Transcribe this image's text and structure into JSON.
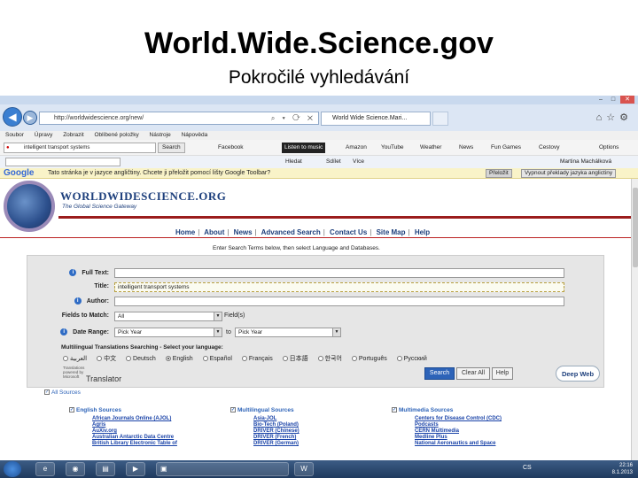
{
  "slide": {
    "title": "World.Wide.Science.gov",
    "subtitle": "Pokročilé vyhledávání"
  },
  "browser": {
    "address": "http://worldwidescience.org/new/",
    "tab_title": "World Wide Science.Mari...",
    "menu": [
      "Soubor",
      "Úpravy",
      "Zobrazit",
      "Oblíbené položky",
      "Nástroje",
      "Nápověda"
    ],
    "toolbar": {
      "search_value": "intelligent transport systems",
      "search_button": "Search",
      "items": [
        "Facebook",
        "Listen to music",
        "Amazon",
        "YouTube",
        "Weather",
        "News",
        "Fun Games",
        "Cestovy",
        "Options"
      ]
    },
    "google_toolbar": {
      "items": [
        "Hledat",
        "Sdílet",
        "Více",
        "Martina Machálková"
      ]
    },
    "translate_bar": {
      "logo": "Google",
      "message": "Tato stránka je v jazyce angličtiny. Chcete ji přeložit pomocí lišty Google Toolbar?",
      "button_translate": "Přeložit",
      "button_always": "Vypnout překlady jazyka anglictiny"
    }
  },
  "site": {
    "logo_text": "WORLDWIDESCIENCE.ORG",
    "tagline": "The Global Science Gateway",
    "nav": [
      "Home",
      "About",
      "News",
      "Advanced Search",
      "Contact Us",
      "Site Map",
      "Help"
    ],
    "instruction": "Enter Search Terms below, then select Language and Databases.",
    "form": {
      "full_text_label": "Full Text:",
      "full_text_value": "",
      "title_label": "Title:",
      "title_value": "intelligent transport systems",
      "author_label": "Author:",
      "author_value": "",
      "fields_label": "Fields to Match:",
      "fields_value": "All",
      "fields_suffix": "Field(s)",
      "date_label": "Date Range:",
      "date_from": "Pick Year",
      "date_to_label": "to",
      "date_to": "Pick Year"
    },
    "multilingual_heading": "Multilingual Translations Searching - Select your language:",
    "languages": [
      "العربية",
      "中文",
      "Deutsch",
      "English",
      "Español",
      "Français",
      "日本語",
      "한국어",
      "Português",
      "Русский"
    ],
    "selected_language": "English",
    "translator_small": "Translations powered by Microsoft",
    "translator_label": "Translator",
    "buttons": {
      "search": "Search",
      "clear": "Clear All",
      "help": "Help"
    },
    "deepweb_logo": "Deep Web",
    "sources": {
      "all_label": "All Sources",
      "english_head": "English Sources",
      "english": [
        "African Journals Online (AJOL)",
        "Agris",
        "AuXiv.org",
        "Australian Antarctic Data Centre",
        "British Library Electronic Table of"
      ],
      "multilingual_head": "Multilingual Sources",
      "multilingual": [
        "Asia-JOL",
        "Bio-Tech (Poland)",
        "DRIVER (Chinese)",
        "DRIVER (French)",
        "DRIVER (German)"
      ],
      "multimedia_head": "Multimedia Sources",
      "multimedia": [
        "Centers for Disease Control (CDC)",
        "Podcasts",
        "CERN Multimedia",
        "Medline Plus",
        "National Aeronautics and Space"
      ]
    }
  },
  "taskbar": {
    "language": "CS",
    "time": "22:16",
    "date": "8.1.2013"
  }
}
